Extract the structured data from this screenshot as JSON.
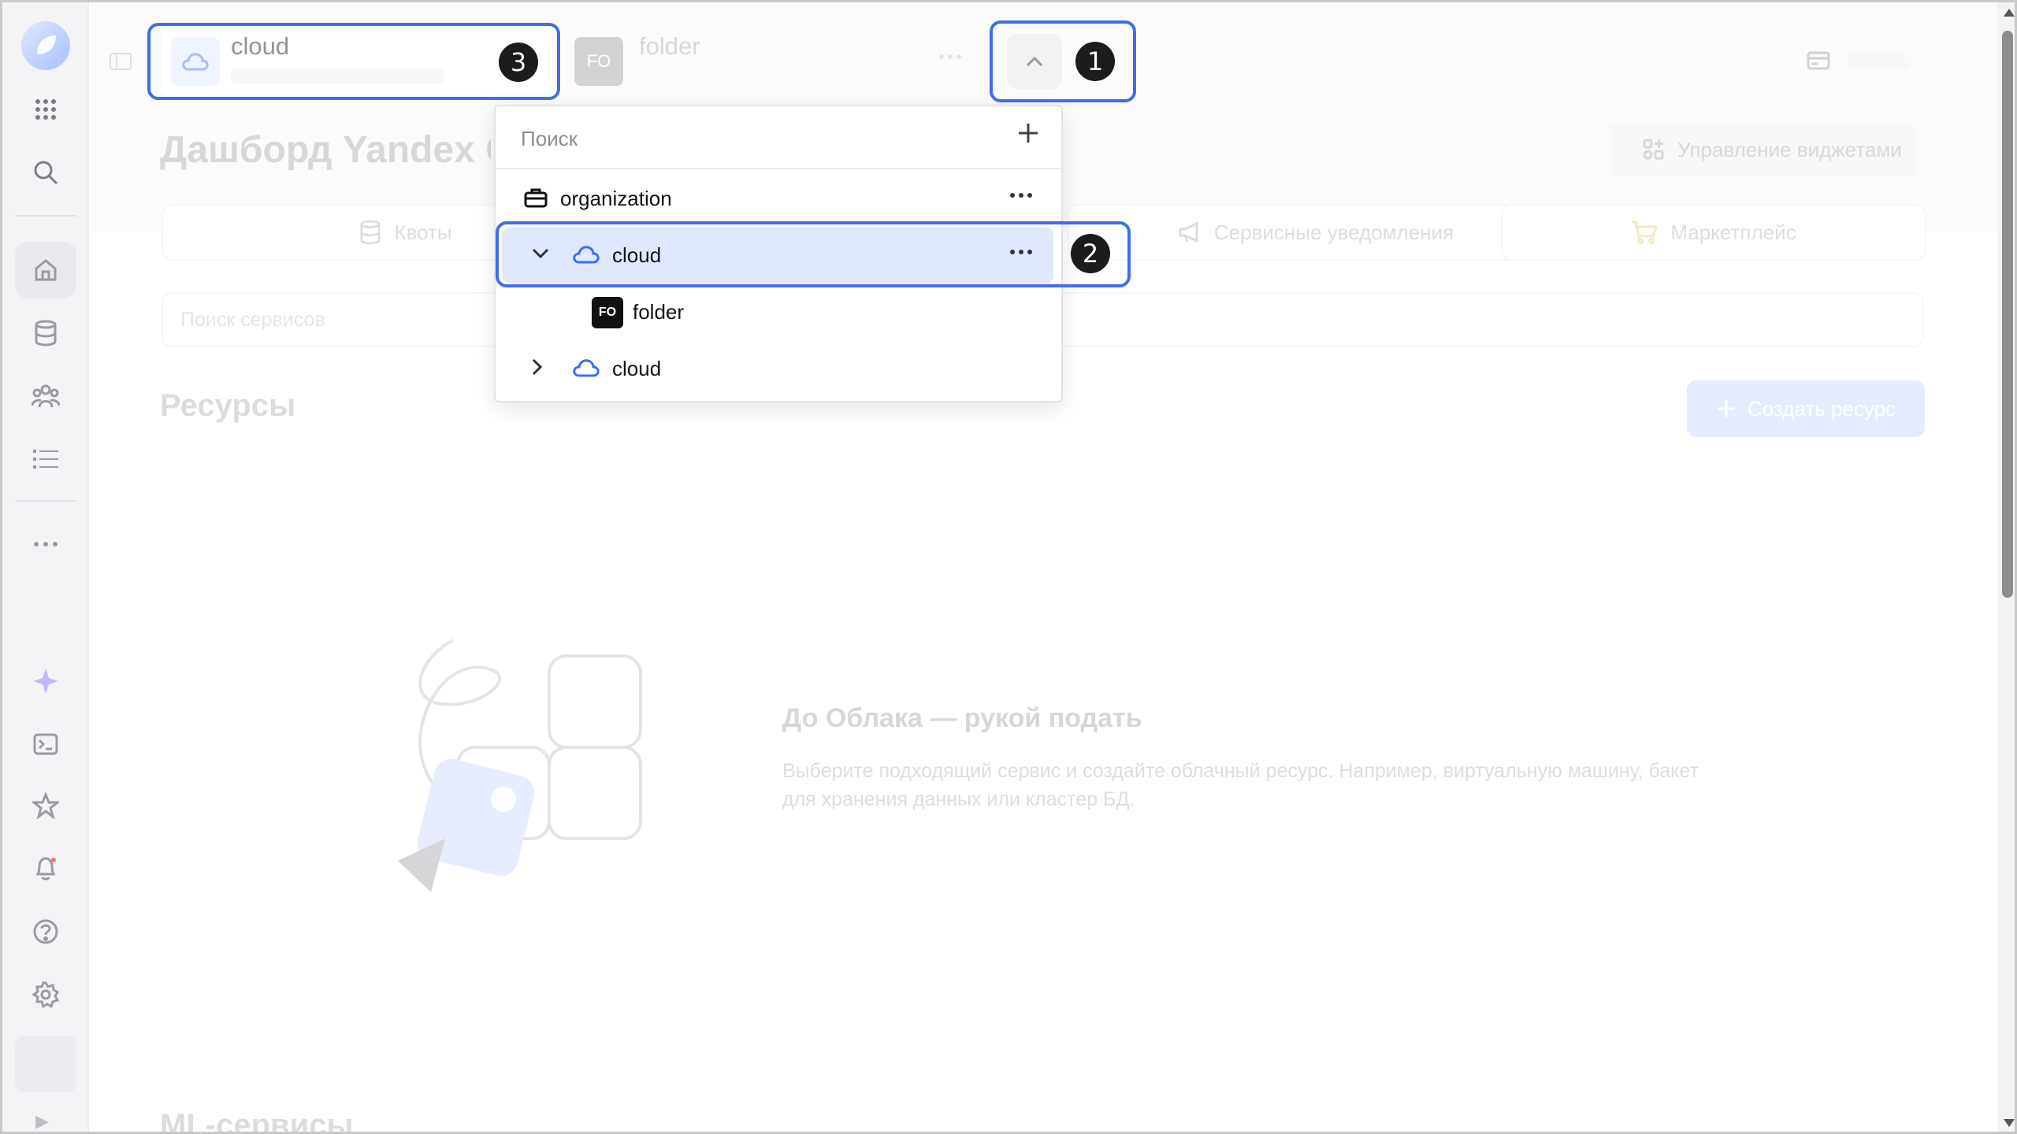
{
  "breadcrumbs": {
    "cloud_label": "cloud",
    "folder_badge": "FO",
    "folder_label": "folder",
    "more_label": "•••"
  },
  "page": {
    "title": "Дашборд Yandex C",
    "manage_widgets": "Управление виджетами",
    "tabs": [
      {
        "label": "Квоты",
        "icon": "database-icon"
      },
      {
        "label": "Сервисные уведомления",
        "icon": "megaphone-icon"
      },
      {
        "label": "Маркетплейс",
        "icon": "cart-icon"
      }
    ],
    "service_search_placeholder": "Поиск сервисов",
    "resources_title": "Ресурсы",
    "create_resource": "Создать ресурс",
    "empty_title": "До Облака — рукой подать",
    "empty_text": "Выберите подходящий сервис и создайте облачный ресурс. Например, виртуальную машину, бакет для хранения данных или кластер БД.",
    "ml_title": "ML-сервисы"
  },
  "dropdown": {
    "search_placeholder": "Поиск",
    "items": [
      {
        "label": "organization",
        "icon": "briefcase-icon"
      },
      {
        "label": "cloud",
        "icon": "cloud-icon",
        "expanded": true,
        "selected": true
      },
      {
        "label": "folder",
        "icon": "folder-badge-icon",
        "badge": "FO"
      },
      {
        "label": "cloud",
        "icon": "cloud-icon",
        "expanded": false
      }
    ]
  },
  "callouts": [
    "1",
    "2",
    "3"
  ],
  "colors": {
    "accent": "#3f6df0",
    "selected_row": "#e0e8fd",
    "badge": "#1c1c1c",
    "create_button": "#c8d6ff"
  },
  "sidebar": {
    "icons": [
      "logo-icon",
      "apps-grid-icon",
      "search-icon",
      "home-icon",
      "database-icon",
      "users-icon",
      "list-icon",
      "more-icon",
      "sparkle-icon",
      "terminal-icon",
      "star-icon",
      "bell-icon",
      "help-icon",
      "settings-icon"
    ]
  }
}
